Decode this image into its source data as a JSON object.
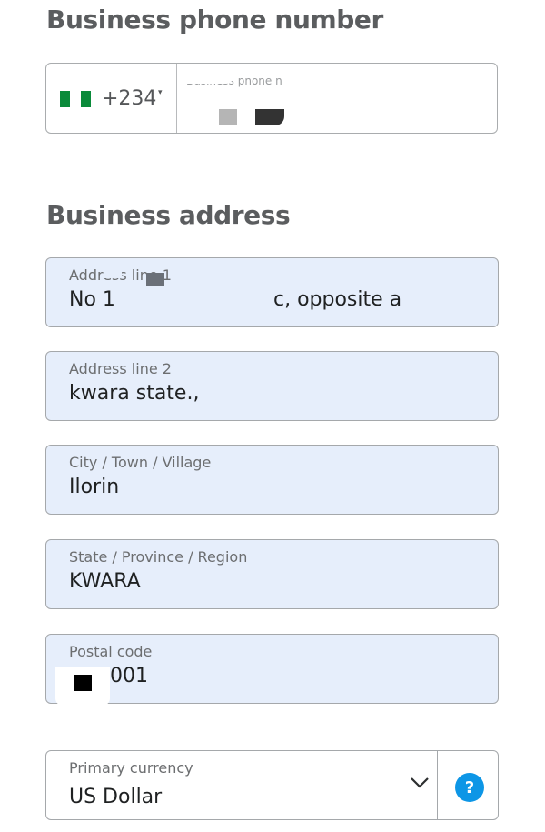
{
  "phone_section": {
    "title": "Business phone number",
    "country_code": "+234",
    "caret": "▾",
    "label": "Business phone n"
  },
  "address_section": {
    "title": "Business address",
    "fields": {
      "address_line_1": {
        "label": "Address line 1",
        "value_start": "No 1",
        "value_end": "c, opposite a"
      },
      "address_line_2": {
        "label": "Address line 2",
        "value": "kwara state.,"
      },
      "city": {
        "label": "City / Town / Village",
        "value": "Ilorin"
      },
      "state": {
        "label": "State / Province / Region",
        "value": "KWARA"
      },
      "postal_code": {
        "label": "Postal code",
        "value": "001"
      }
    }
  },
  "currency": {
    "label": "Primary currency",
    "value": "US Dollar",
    "help": "?"
  },
  "icons": {
    "flag": "nigeria-flag-icon",
    "dropdown": "chevron-down-icon",
    "help": "help-icon"
  },
  "colors": {
    "field_background": "#e6eefb",
    "help_accent": "#0d96e6",
    "heading": "#5b5d5f"
  }
}
